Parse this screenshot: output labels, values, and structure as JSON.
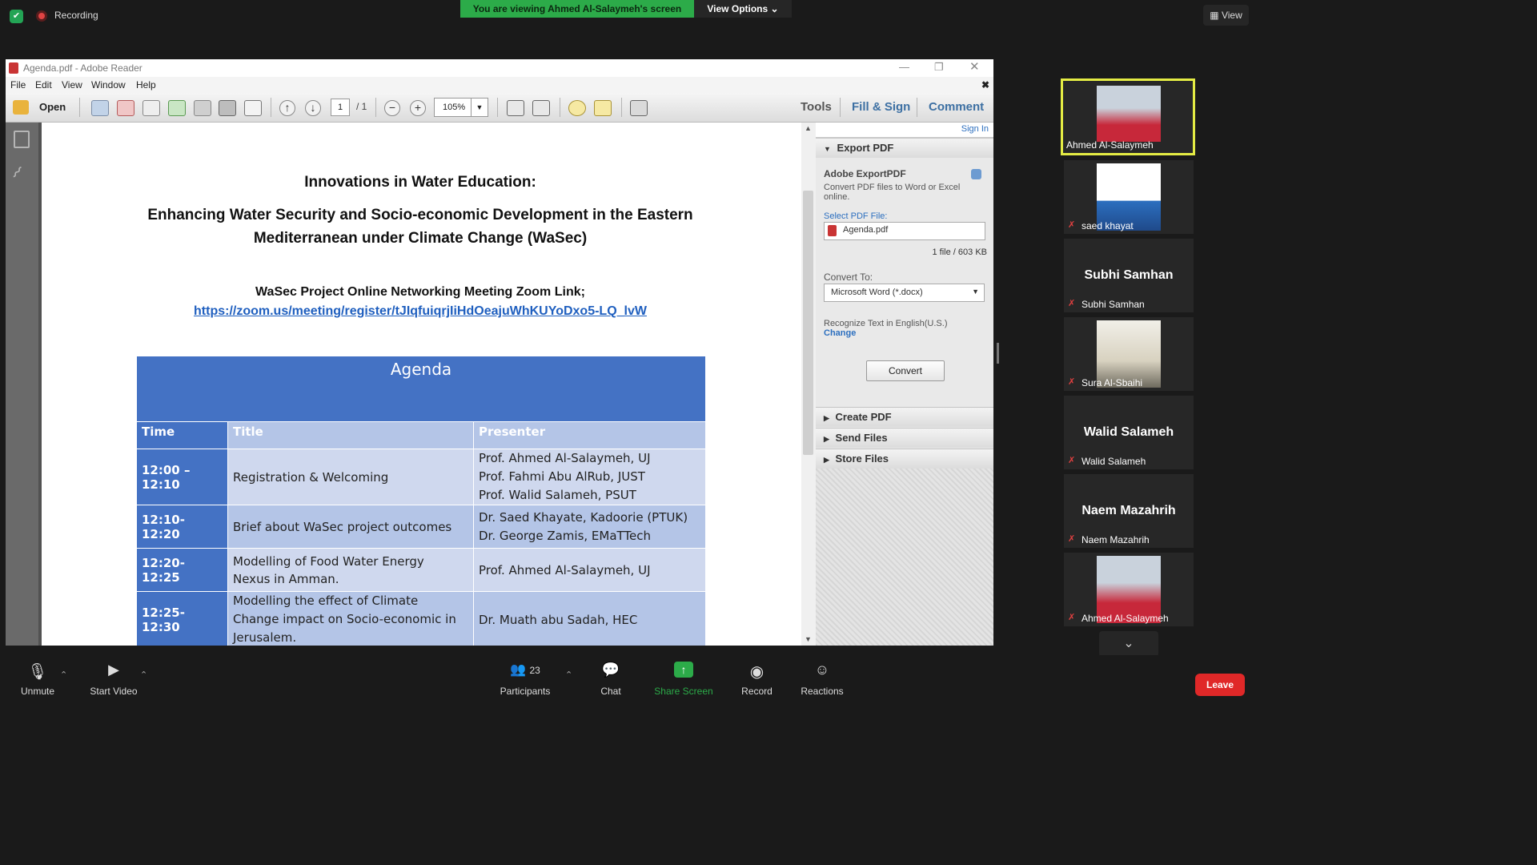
{
  "meeting": {
    "recording_label": "Recording",
    "viewing_banner": "You are viewing Ahmed Al-Salaymeh's screen",
    "view_options": "View Options",
    "view_button": "View"
  },
  "adobe": {
    "window_title": "Agenda.pdf - Adobe Reader",
    "menu": [
      "File",
      "Edit",
      "View",
      "Window",
      "Help"
    ],
    "open_label": "Open",
    "page_current": "1",
    "page_total": "/ 1",
    "zoom": "105%",
    "tabs": [
      "Tools",
      "Fill & Sign",
      "Comment"
    ],
    "sign_in": "Sign In",
    "export_pdf": {
      "header": "Export PDF",
      "service_name": "Adobe ExportPDF",
      "description": "Convert PDF files to Word or Excel online.",
      "select_label": "Select PDF File:",
      "file_name": "Agenda.pdf",
      "file_info": "1 file / 603 KB",
      "convert_to_label": "Convert To:",
      "convert_to_value": "Microsoft Word (*.docx)",
      "recognize_text": "Recognize Text in English(U.S.)",
      "change_link": "Change",
      "convert_button": "Convert"
    },
    "sections": [
      "Create PDF",
      "Send Files",
      "Store Files"
    ]
  },
  "document": {
    "title": "Innovations in Water Education:",
    "subtitle_line1": "Enhancing Water Security and Socio-economic Development in the Eastern",
    "subtitle_line2": "Mediterranean under Climate Change (WaSec)",
    "meeting_line": "WaSec Project Online Networking Meeting  Zoom Link;",
    "zoom_link": "https://zoom.us/meeting/register/tJIqfuiqrjIiHdOeajuWhKUYoDxo5-LQ_lvW",
    "agenda_heading": "Agenda",
    "columns": [
      "Time",
      "Title",
      "Presenter"
    ],
    "rows": [
      {
        "time": "12:00 – 12:10",
        "title": [
          "Registration & Welcoming"
        ],
        "presenter": [
          "Prof. Ahmed Al-Salaymeh, UJ",
          "Prof. Fahmi Abu AlRub, JUST",
          "Prof. Walid Salameh, PSUT"
        ]
      },
      {
        "time": "12:10-12:20",
        "title": [
          "Brief about WaSec project outcomes"
        ],
        "presenter": [
          "Dr. Saed Khayate, Kadoorie (PTUK)",
          "Dr. George Zamis, EMaTTech"
        ]
      },
      {
        "time": "12:20-12:25",
        "title": [
          "Modelling of Food Water Energy",
          "Nexus in Amman."
        ],
        "presenter": [
          "Prof. Ahmed Al-Salaymeh, UJ"
        ]
      },
      {
        "time": "12:25-12:30",
        "title": [
          "Modelling the effect of Climate",
          "Change impact on Socio-economic in",
          "Jerusalem."
        ],
        "presenter": [
          "Dr. Muath abu Sadah, HEC"
        ]
      }
    ]
  },
  "participants_gallery": [
    {
      "name": "Ahmed Al-Salaymeh",
      "display": "photo",
      "active_speaker": true,
      "muted": false
    },
    {
      "name": "saed khayat",
      "display": "logo",
      "muted": true
    },
    {
      "name": "Subhi Samhan",
      "display": "text",
      "muted": true
    },
    {
      "name": "Sura Al-Sbaihi",
      "display": "photo",
      "muted": true
    },
    {
      "name": "Walid Salameh",
      "display": "text",
      "muted": true
    },
    {
      "name": "Naem Mazahrih",
      "display": "text",
      "muted": true
    },
    {
      "name": "Ahmed Al-Salaymeh",
      "display": "photo",
      "muted": true
    }
  ],
  "controls": {
    "unmute": "Unmute",
    "start_video": "Start Video",
    "participants": "Participants",
    "participants_count": "23",
    "chat": "Chat",
    "share_screen": "Share Screen",
    "record": "Record",
    "reactions": "Reactions",
    "leave": "Leave"
  },
  "colors": {
    "share_green": "#2cab49",
    "leave_red": "#e02828",
    "agenda_blue": "#4472c4",
    "row_light": "#cfd8ee",
    "row_mid": "#b4c5e7",
    "active_speaker_border": "#e4ec44"
  }
}
